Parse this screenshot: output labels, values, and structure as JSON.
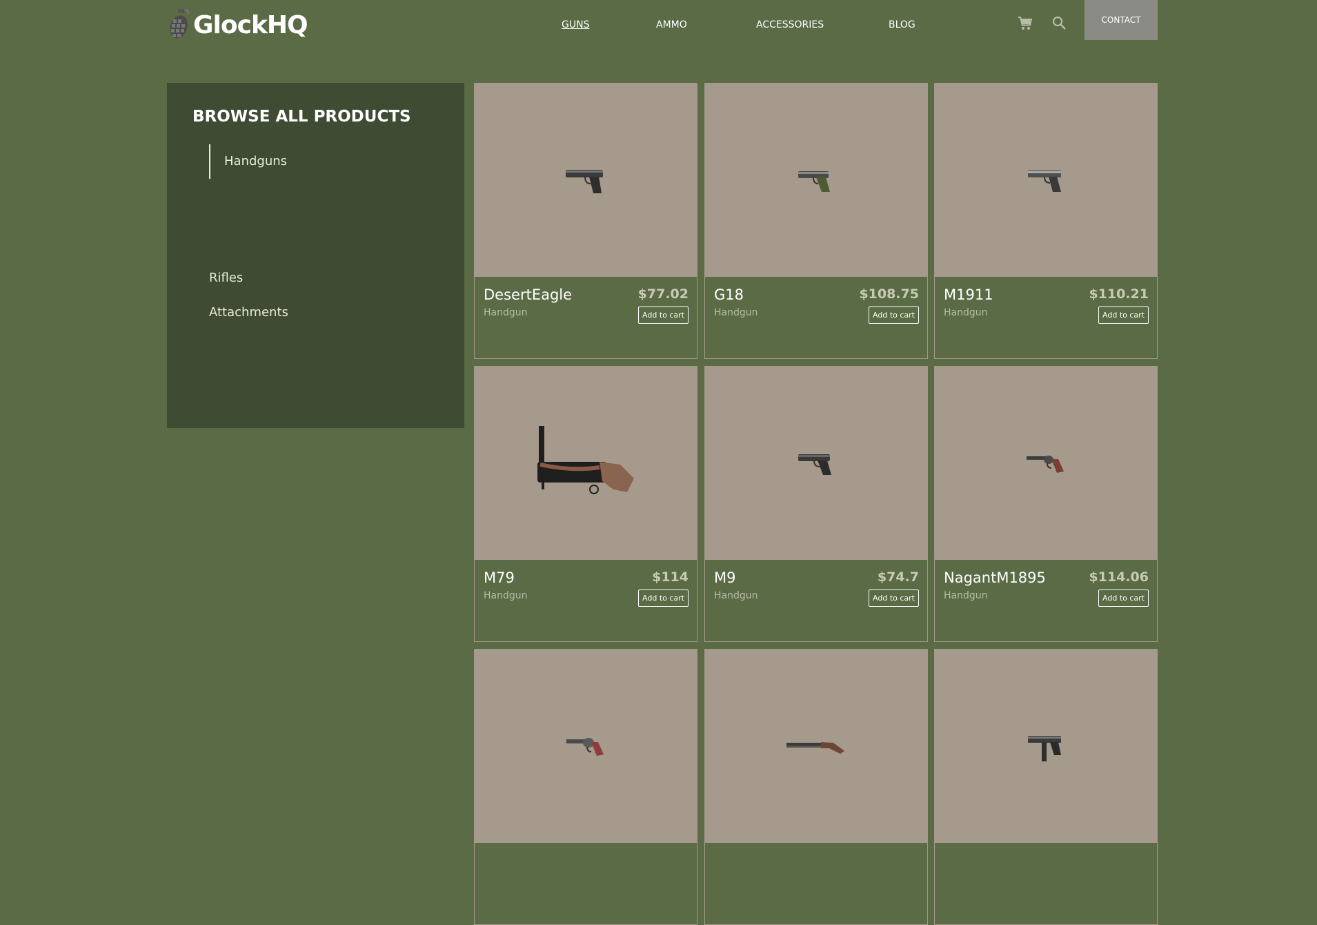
{
  "brand": {
    "name": "GlockHQ",
    "logo_icon": "grenade-icon"
  },
  "nav": {
    "items": [
      {
        "label": "GUNS",
        "active": true
      },
      {
        "label": "AMMO",
        "active": false
      },
      {
        "label": "ACCESSORIES",
        "active": false
      },
      {
        "label": "BLOG",
        "active": false
      }
    ],
    "cart_icon": "cart-icon",
    "search_icon": "search-icon",
    "contact_label": "CONTACT"
  },
  "sidebar": {
    "title": "BROWSE ALL PRODUCTS",
    "items": [
      {
        "label": "Handguns",
        "active": true
      },
      {
        "label": "Rifles",
        "active": false
      },
      {
        "label": "Attachments",
        "active": false
      }
    ]
  },
  "products": [
    {
      "name": "DesertEagle",
      "category": "Handgun",
      "price": "$77.02",
      "button": "Add to cart",
      "image": "pistol-icon"
    },
    {
      "name": "G18",
      "category": "Handgun",
      "price": "$108.75",
      "button": "Add to cart",
      "image": "pistol-icon"
    },
    {
      "name": "M1911",
      "category": "Handgun",
      "price": "$110.21",
      "button": "Add to cart",
      "image": "pistol-icon"
    },
    {
      "name": "M79",
      "category": "Handgun",
      "price": "$114",
      "button": "Add to cart",
      "image": "grenade-launcher-icon"
    },
    {
      "name": "M9",
      "category": "Handgun",
      "price": "$74.7",
      "button": "Add to cart",
      "image": "pistol-icon"
    },
    {
      "name": "NagantM1895",
      "category": "Handgun",
      "price": "$114.06",
      "button": "Add to cart",
      "image": "revolver-icon"
    },
    {
      "image": "revolver-icon"
    },
    {
      "image": "sawed-off-shotgun-icon"
    },
    {
      "image": "machine-pistol-icon"
    }
  ],
  "colors": {
    "page_bg": "#5a6b45",
    "sidebar_bg": "#3f4b32",
    "card_image_bg": "#a59a8b",
    "contact_bg": "#8b8b86"
  }
}
